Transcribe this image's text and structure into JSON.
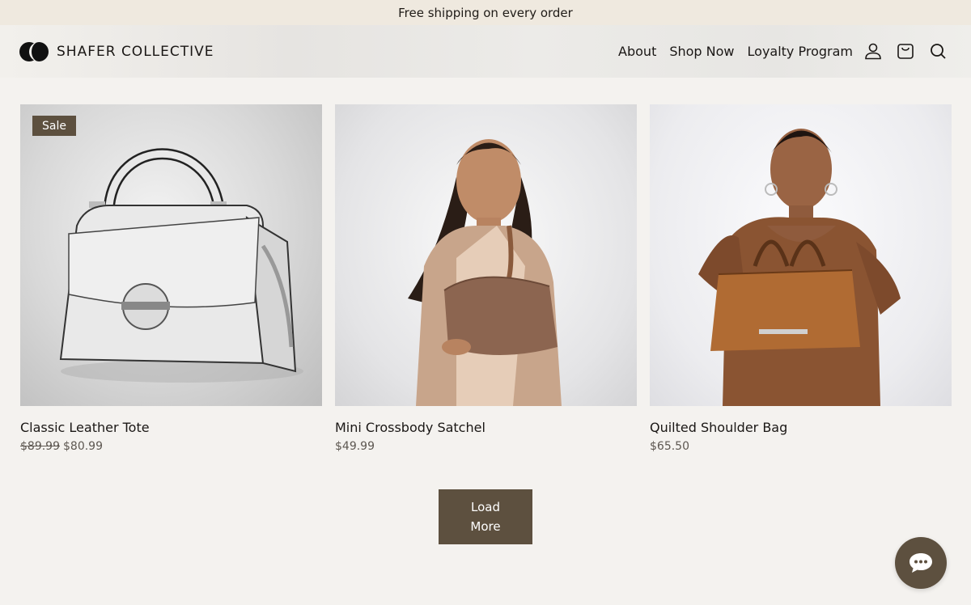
{
  "announcement": "Free shipping on every order",
  "header": {
    "brand": "SHAFER COLLECTIVE",
    "nav": [
      "About",
      "Shop Now",
      "Loyalty Program"
    ],
    "icons": [
      "account-icon",
      "cart-icon",
      "search-icon"
    ]
  },
  "products": [
    {
      "name": "Classic Leather Tote",
      "badge": "Sale",
      "old_price": "$89.99",
      "price": "$80.99"
    },
    {
      "name": "Mini Crossbody Satchel",
      "price": "$49.99"
    },
    {
      "name": "Quilted Shoulder Bag",
      "price": "$65.50"
    }
  ],
  "load_more": {
    "line1": "Load",
    "line2": "More"
  },
  "colors": {
    "accent": "#5d503f",
    "announce_bg": "#efe9df",
    "page_bg": "#f4f2ef"
  }
}
